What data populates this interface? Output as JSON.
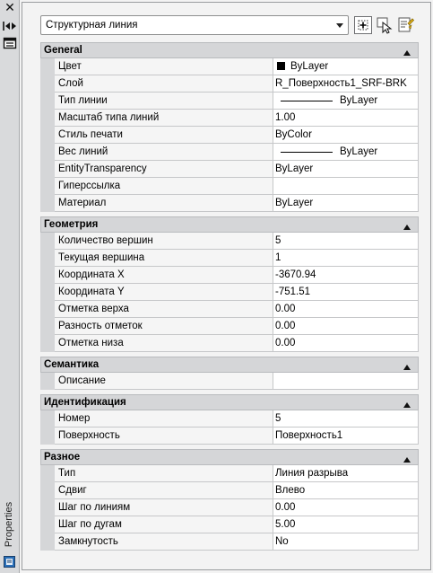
{
  "side_title": "Properties",
  "header": {
    "object_type": "Структурная линия"
  },
  "sections": [
    {
      "title": "General",
      "rows": [
        {
          "name": "Цвет",
          "value": "ByLayer",
          "swatch": true
        },
        {
          "name": "Слой",
          "value": "R_Поверхность1_SRF-BRK"
        },
        {
          "name": "Тип линии",
          "value": "ByLayer",
          "line_sample": true
        },
        {
          "name": "Масштаб типа линий",
          "value": "1.00"
        },
        {
          "name": "Стиль печати",
          "value": "ByColor"
        },
        {
          "name": "Вес линий",
          "value": "ByLayer",
          "line_sample": true
        },
        {
          "name": "EntityTransparency",
          "value": "ByLayer"
        },
        {
          "name": "Гиперссылка",
          "value": ""
        },
        {
          "name": "Материал",
          "value": "ByLayer"
        }
      ]
    },
    {
      "title": "Геометрия",
      "rows": [
        {
          "name": "Количество вершин",
          "value": "5"
        },
        {
          "name": "Текущая вершина",
          "value": "1"
        },
        {
          "name": "Координата X",
          "value": "-3670.94"
        },
        {
          "name": "Координата Y",
          "value": "-751.51"
        },
        {
          "name": "Отметка верха",
          "value": "0.00"
        },
        {
          "name": "Разность отметок",
          "value": "0.00"
        },
        {
          "name": "Отметка низа",
          "value": "0.00"
        }
      ]
    },
    {
      "title": "Семантика",
      "rows": [
        {
          "name": "Описание",
          "value": ""
        }
      ]
    },
    {
      "title": "Идентификация",
      "rows": [
        {
          "name": "Номер",
          "value": "5"
        },
        {
          "name": "Поверхность",
          "value": "Поверхность1"
        }
      ]
    },
    {
      "title": "Разное",
      "rows": [
        {
          "name": "Тип",
          "value": "Линия разрыва"
        },
        {
          "name": "Сдвиг",
          "value": "Влево"
        },
        {
          "name": "Шаг по линиям",
          "value": "0.00"
        },
        {
          "name": "Шаг по дугам",
          "value": "5.00"
        },
        {
          "name": "Замкнутость",
          "value": "No"
        }
      ]
    }
  ],
  "icons": {
    "close": "close-icon",
    "autohide": "auto-hide-icon",
    "properties_menu": "properties-menu-icon",
    "dropdown": "chevron-down-icon",
    "pickadd": "pickadd-toggle-icon",
    "select_objects": "select-objects-icon",
    "quick_select": "quick-select-icon",
    "collapse": "collapse-section-icon",
    "palette": "palette-icon"
  }
}
